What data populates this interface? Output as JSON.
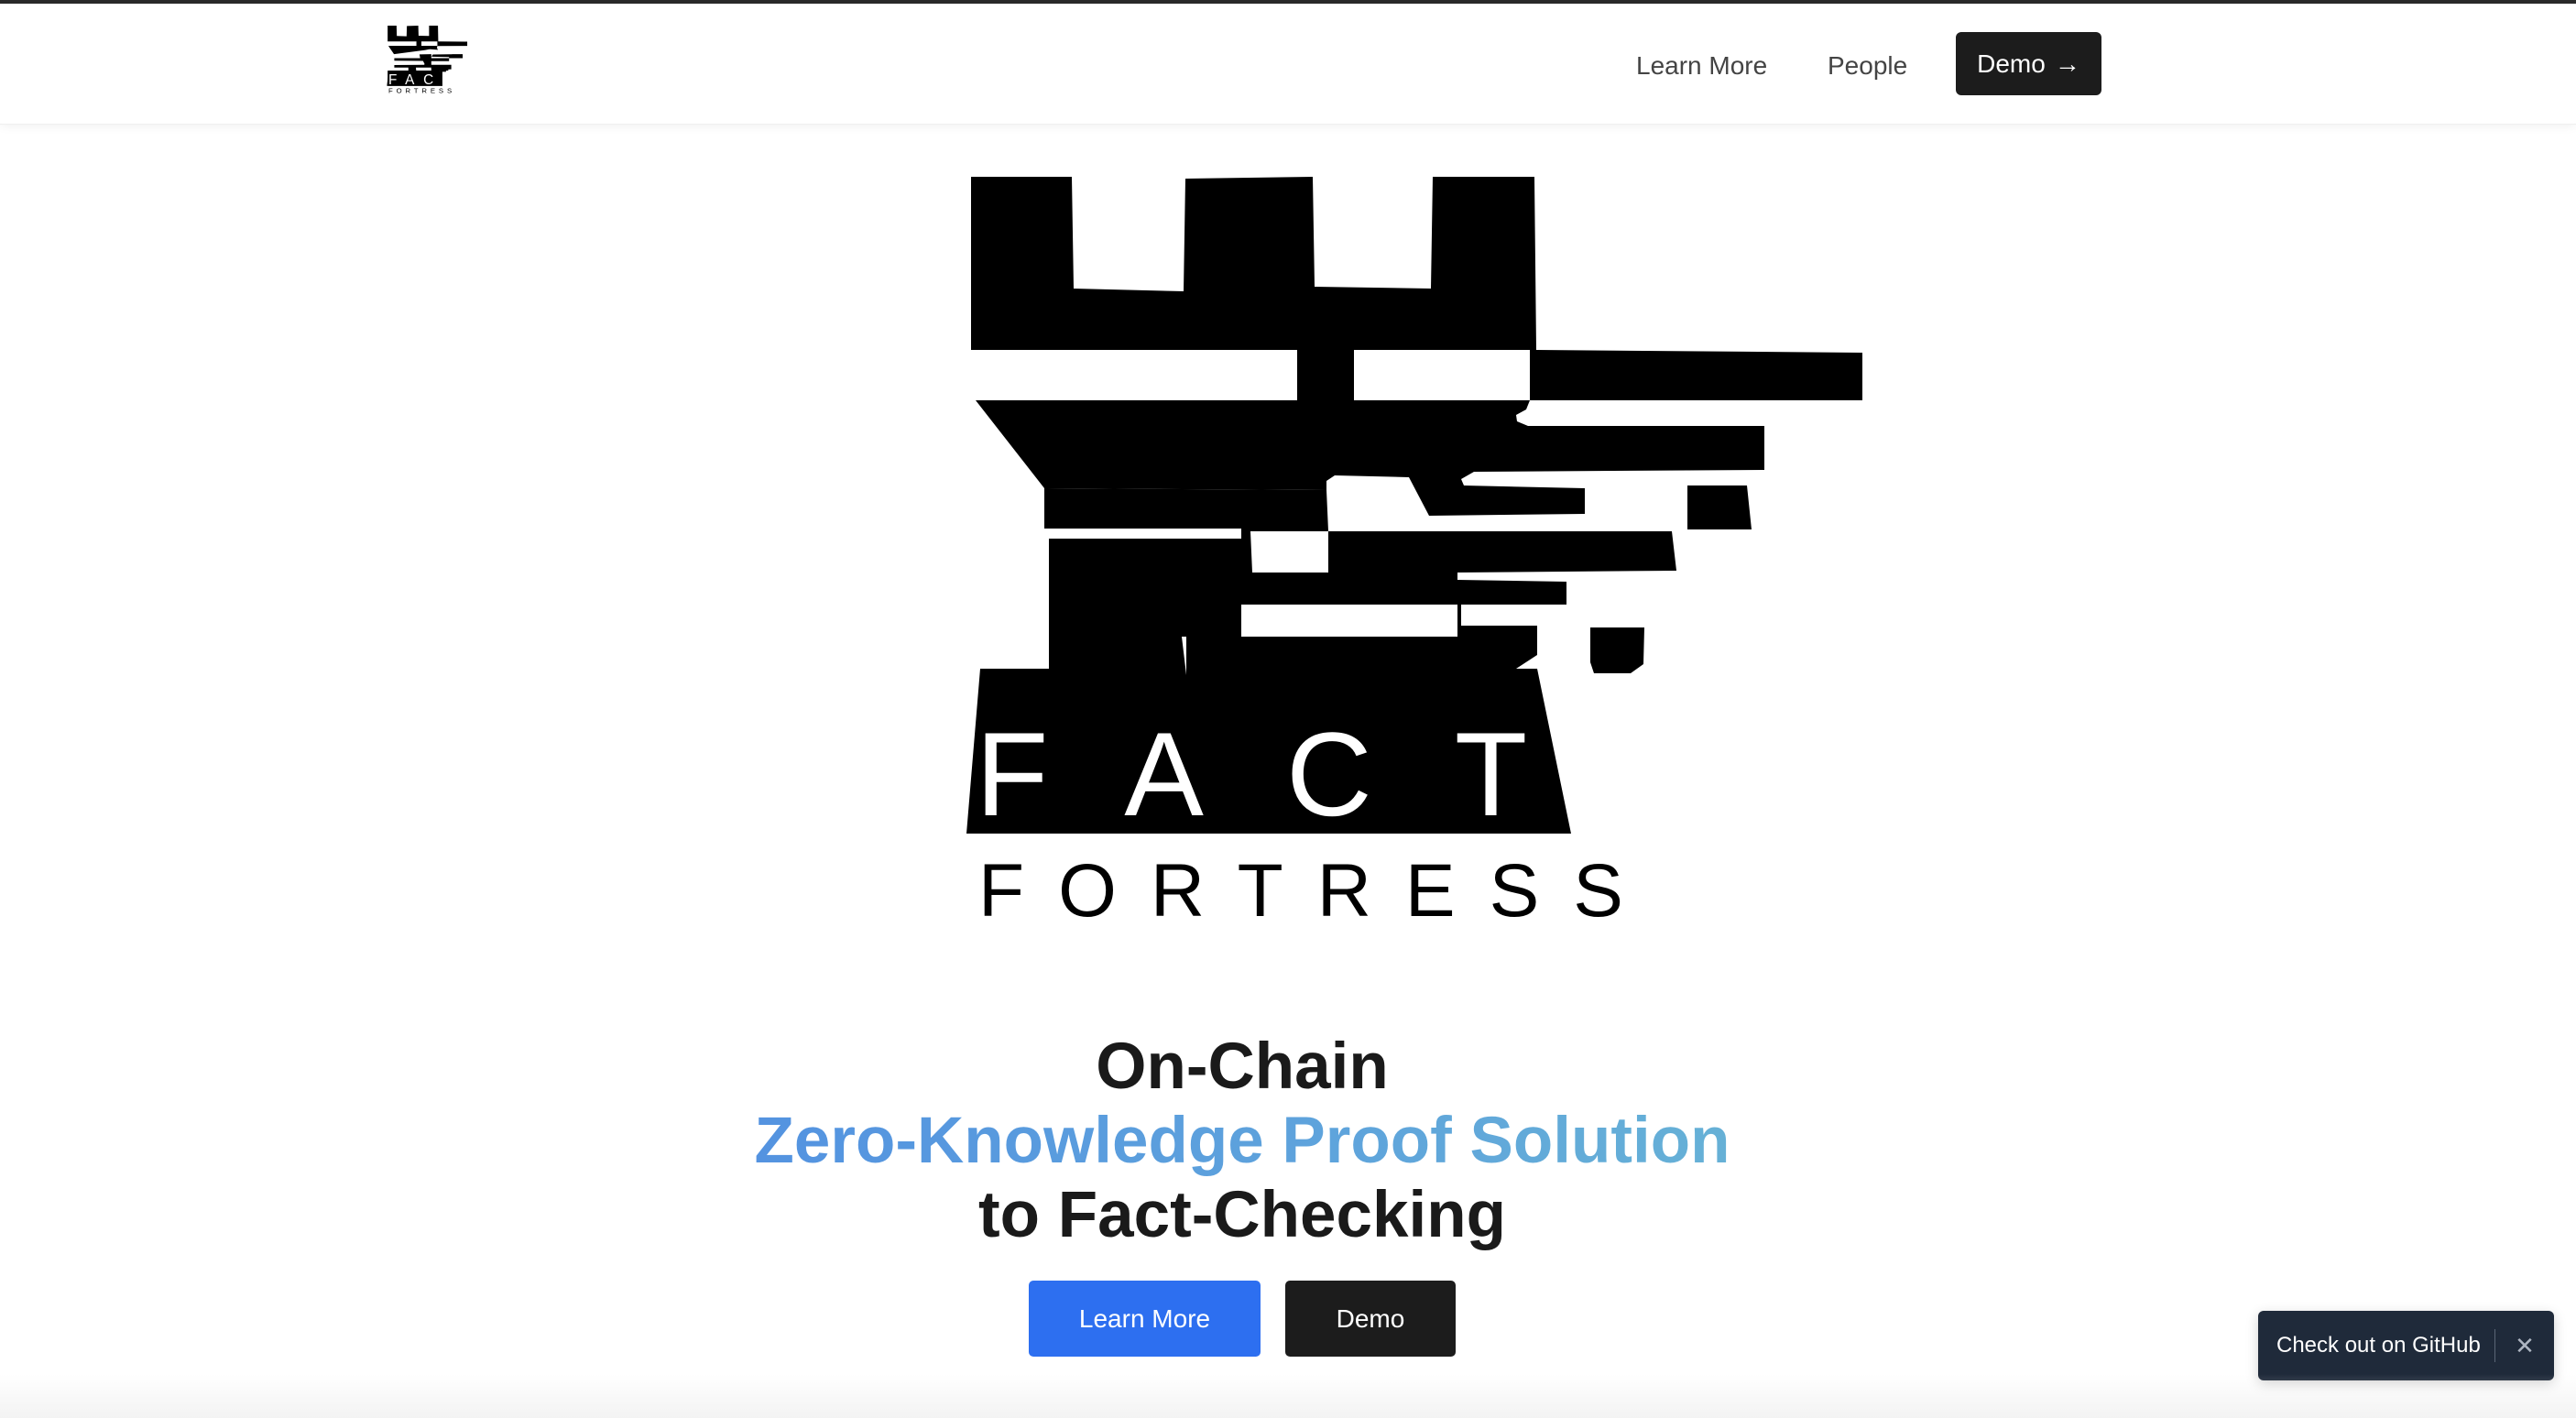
{
  "nav": {
    "links": [
      {
        "label": "Learn More"
      },
      {
        "label": "People"
      }
    ],
    "demo_label": "Demo",
    "demo_icon": "arrow-right-icon"
  },
  "brand": {
    "line1": "FACT",
    "line2": "FORTRESS"
  },
  "hero": {
    "line1": "On-Chain",
    "line2": "Zero-Knowledge Proof Solution",
    "line3": "to Fact-Checking",
    "learn_more_label": "Learn More",
    "demo_label": "Demo",
    "accent_colors": {
      "primary_button": "#2d6ff0",
      "gradient_start": "#4f8ce2",
      "gradient_end": "#6bb9d3",
      "dark_button": "#1c1c1c"
    }
  },
  "toast": {
    "label": "Check out on GitHub",
    "close_icon": "close-icon"
  }
}
